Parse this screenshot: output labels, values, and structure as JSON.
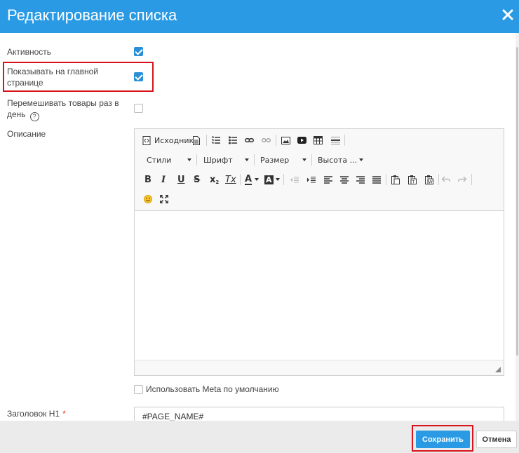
{
  "dialog": {
    "title": "Редактирование списка",
    "close_icon": "close-icon"
  },
  "form": {
    "active": {
      "label": "Активность",
      "checked": true
    },
    "show_on_main": {
      "label_line1": "Показывать на главной",
      "label_line2": "странице",
      "checked": true
    },
    "shuffle": {
      "label_line1": "Перемешивать товары раз в",
      "label_line2": "день",
      "help": "?",
      "checked": false
    },
    "description": {
      "label": "Описание"
    },
    "use_meta": {
      "label": "Использовать Meta по умолчанию",
      "checked": false
    },
    "h1": {
      "label": "Заголовок H1",
      "required_mark": "*",
      "value": "#PAGE_NAME#"
    }
  },
  "editor": {
    "toolbar_row1": {
      "source_label": "Исходник",
      "icons": [
        "source-icon",
        "document-icon",
        "numbered-list-icon",
        "bullet-list-icon",
        "link-icon",
        "unlink-icon",
        "image-icon",
        "youtube-icon",
        "table-icon",
        "horizontal-rule-icon"
      ]
    },
    "toolbar_row2": {
      "styles": "Стили",
      "font": "Шрифт",
      "size": "Размер",
      "height": "Высота ..."
    },
    "toolbar_row3": {
      "bold": "B",
      "italic": "I",
      "underline": "U",
      "strike": "S",
      "subscript": "x",
      "clear_format": "Tx",
      "text_color": "A",
      "bg_color": "A"
    },
    "toolbar_row4": {
      "icons": [
        "smiley-icon",
        "maximize-icon"
      ]
    }
  },
  "footer": {
    "save_label": "Сохранить",
    "cancel_label": "Отмена"
  },
  "colors": {
    "header": "#2a9ae4",
    "highlight": "#d8131b",
    "checkbox": "#2a8fd6"
  }
}
